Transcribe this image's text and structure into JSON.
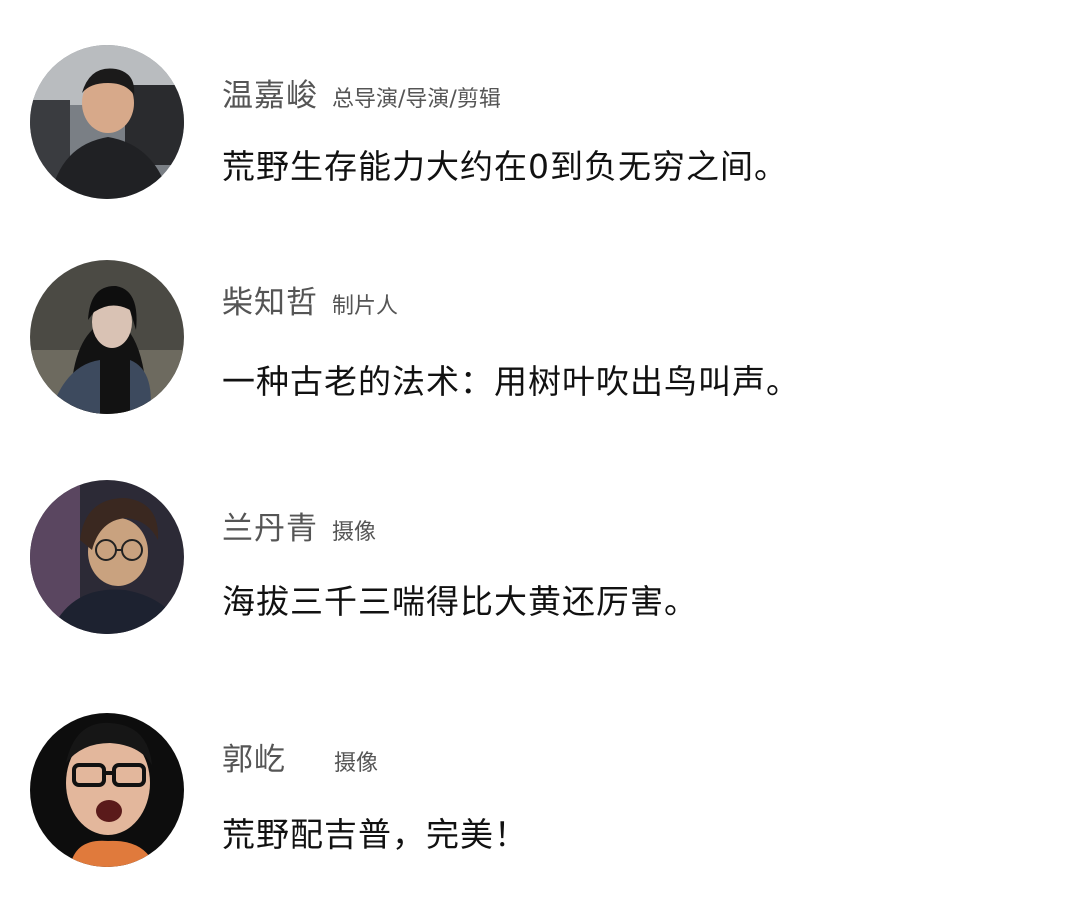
{
  "entries": [
    {
      "name": "温嘉峻",
      "role": "总导演/导演/剪辑",
      "quote": "荒野生存能力大约在0到负无穷之间。",
      "avatar_icon": "person-portrait-car-icon"
    },
    {
      "name": "柴知哲",
      "role": "制片人",
      "quote": "一种古老的法术：用树叶吹出鸟叫声。",
      "avatar_icon": "person-portrait-night-icon"
    },
    {
      "name": "兰丹青",
      "role": "摄像",
      "quote": "海拔三千三喘得比大黄还厉害。",
      "avatar_icon": "person-portrait-glasses-icon"
    },
    {
      "name": "郭屹",
      "role": "摄像",
      "quote": "荒野配吉普，完美！",
      "avatar_icon": "person-portrait-shouting-icon"
    }
  ]
}
